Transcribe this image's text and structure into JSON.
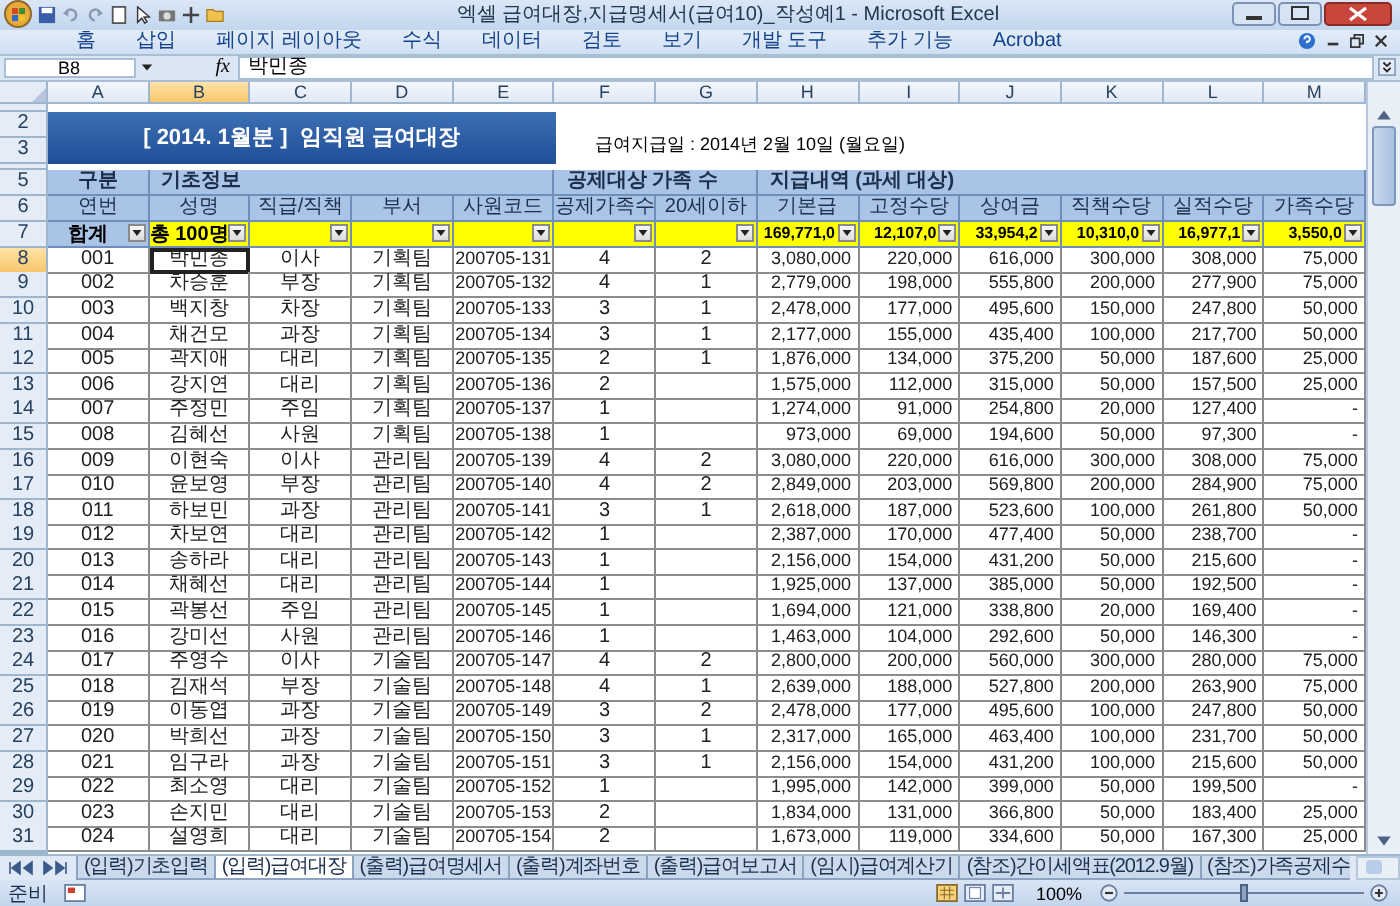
{
  "window": {
    "title": "엑셀 급여대장,지급명세서(급여10)_작성예1 - Microsoft Excel"
  },
  "ribbon_tabs": [
    "홈",
    "삽입",
    "페이지 레이아웃",
    "수식",
    "데이터",
    "검토",
    "보기",
    "개발 도구",
    "추가 기능",
    "Acrobat"
  ],
  "formula_bar": {
    "name_box": "B8",
    "function_label": "fx",
    "formula": "박민종"
  },
  "columns": [
    {
      "label": "A",
      "selected": false
    },
    {
      "label": "B",
      "selected": true
    },
    {
      "label": "C",
      "selected": false
    },
    {
      "label": "D",
      "selected": false
    },
    {
      "label": "E",
      "selected": false
    },
    {
      "label": "F",
      "selected": false
    },
    {
      "label": "G",
      "selected": false
    },
    {
      "label": "H",
      "selected": false
    },
    {
      "label": "I",
      "selected": false
    },
    {
      "label": "J",
      "selected": false
    },
    {
      "label": "K",
      "selected": false
    },
    {
      "label": "L",
      "selected": false
    },
    {
      "label": "M",
      "selected": false
    }
  ],
  "sheet": {
    "title_row_numbers": [
      "2",
      "3"
    ],
    "title": "[ 2014. 1월분 ]  임직원 급여대장",
    "pay_date": "급여지급일 : 2014년 2월 10일 (월요일)",
    "group_row_number": "5",
    "group_headers": [
      {
        "label": "구분"
      },
      {
        "label": "기초정보"
      },
      {
        "label": "공제대상 가족 수"
      },
      {
        "label": "지급내역 (과세 대상)"
      }
    ],
    "header_row_number": "6",
    "column_headers": [
      "연번",
      "성명",
      "직급/직책",
      "부서",
      "사원코드",
      "공제가족수",
      "20세이하",
      "기본급",
      "고정수당",
      "상여금",
      "직책수당",
      "실적수당",
      "가족수당"
    ],
    "totals_row_number": "7",
    "totals": [
      {
        "text": "합계",
        "filter": true
      },
      {
        "text": "총 100명",
        "filter": true
      },
      {
        "filter": true
      },
      {
        "filter": true
      },
      {
        "filter": true
      },
      {
        "filter": true
      },
      {
        "filter": true
      },
      {
        "text": "169,771,0",
        "filter": true
      },
      {
        "text": "12,107,0",
        "filter": true
      },
      {
        "text": "33,954,2",
        "filter": true
      },
      {
        "text": "10,310,0",
        "filter": true
      },
      {
        "text": "16,977,1",
        "filter": true
      },
      {
        "text": "3,550,0",
        "filter": true
      }
    ],
    "rows": [
      {
        "row_number": "8",
        "selected": true,
        "cells": [
          "001",
          "박민종",
          "이사",
          "기획팀",
          "200705-131",
          "4",
          "2",
          "3,080,000",
          "220,000",
          "616,000",
          "300,000",
          "308,000",
          "75,000"
        ]
      },
      {
        "row_number": "9",
        "selected": false,
        "cells": [
          "002",
          "차승훈",
          "부장",
          "기획팀",
          "200705-132",
          "4",
          "1",
          "2,779,000",
          "198,000",
          "555,800",
          "200,000",
          "277,900",
          "75,000"
        ]
      },
      {
        "row_number": "10",
        "selected": false,
        "cells": [
          "003",
          "백지창",
          "차장",
          "기획팀",
          "200705-133",
          "3",
          "1",
          "2,478,000",
          "177,000",
          "495,600",
          "150,000",
          "247,800",
          "50,000"
        ]
      },
      {
        "row_number": "11",
        "selected": false,
        "cells": [
          "004",
          "채건모",
          "과장",
          "기획팀",
          "200705-134",
          "3",
          "1",
          "2,177,000",
          "155,000",
          "435,400",
          "100,000",
          "217,700",
          "50,000"
        ]
      },
      {
        "row_number": "12",
        "selected": false,
        "cells": [
          "005",
          "곽지애",
          "대리",
          "기획팀",
          "200705-135",
          "2",
          "1",
          "1,876,000",
          "134,000",
          "375,200",
          "50,000",
          "187,600",
          "25,000"
        ]
      },
      {
        "row_number": "13",
        "selected": false,
        "cells": [
          "006",
          "강지연",
          "대리",
          "기획팀",
          "200705-136",
          "2",
          "",
          "1,575,000",
          "112,000",
          "315,000",
          "50,000",
          "157,500",
          "25,000"
        ]
      },
      {
        "row_number": "14",
        "selected": false,
        "cells": [
          "007",
          "주정민",
          "주임",
          "기획팀",
          "200705-137",
          "1",
          "",
          "1,274,000",
          "91,000",
          "254,800",
          "20,000",
          "127,400",
          "-"
        ]
      },
      {
        "row_number": "15",
        "selected": false,
        "cells": [
          "008",
          "김혜선",
          "사원",
          "기획팀",
          "200705-138",
          "1",
          "",
          "973,000",
          "69,000",
          "194,600",
          "50,000",
          "97,300",
          "-"
        ]
      },
      {
        "row_number": "16",
        "selected": false,
        "cells": [
          "009",
          "이현숙",
          "이사",
          "관리팀",
          "200705-139",
          "4",
          "2",
          "3,080,000",
          "220,000",
          "616,000",
          "300,000",
          "308,000",
          "75,000"
        ]
      },
      {
        "row_number": "17",
        "selected": false,
        "cells": [
          "010",
          "윤보영",
          "부장",
          "관리팀",
          "200705-140",
          "4",
          "2",
          "2,849,000",
          "203,000",
          "569,800",
          "200,000",
          "284,900",
          "75,000"
        ]
      },
      {
        "row_number": "18",
        "selected": false,
        "cells": [
          "011",
          "하보민",
          "과장",
          "관리팀",
          "200705-141",
          "3",
          "1",
          "2,618,000",
          "187,000",
          "523,600",
          "100,000",
          "261,800",
          "50,000"
        ]
      },
      {
        "row_number": "19",
        "selected": false,
        "cells": [
          "012",
          "차보연",
          "대리",
          "관리팀",
          "200705-142",
          "1",
          "",
          "2,387,000",
          "170,000",
          "477,400",
          "50,000",
          "238,700",
          "-"
        ]
      },
      {
        "row_number": "20",
        "selected": false,
        "cells": [
          "013",
          "송하라",
          "대리",
          "관리팀",
          "200705-143",
          "1",
          "",
          "2,156,000",
          "154,000",
          "431,200",
          "50,000",
          "215,600",
          "-"
        ]
      },
      {
        "row_number": "21",
        "selected": false,
        "cells": [
          "014",
          "채혜선",
          "대리",
          "관리팀",
          "200705-144",
          "1",
          "",
          "1,925,000",
          "137,000",
          "385,000",
          "50,000",
          "192,500",
          "-"
        ]
      },
      {
        "row_number": "22",
        "selected": false,
        "cells": [
          "015",
          "곽봉선",
          "주임",
          "관리팀",
          "200705-145",
          "1",
          "",
          "1,694,000",
          "121,000",
          "338,800",
          "20,000",
          "169,400",
          "-"
        ]
      },
      {
        "row_number": "23",
        "selected": false,
        "cells": [
          "016",
          "강미선",
          "사원",
          "관리팀",
          "200705-146",
          "1",
          "",
          "1,463,000",
          "104,000",
          "292,600",
          "50,000",
          "146,300",
          "-"
        ]
      },
      {
        "row_number": "24",
        "selected": false,
        "cells": [
          "017",
          "주영수",
          "이사",
          "기술팀",
          "200705-147",
          "4",
          "2",
          "2,800,000",
          "200,000",
          "560,000",
          "300,000",
          "280,000",
          "75,000"
        ]
      },
      {
        "row_number": "25",
        "selected": false,
        "cells": [
          "018",
          "김재석",
          "부장",
          "기술팀",
          "200705-148",
          "4",
          "1",
          "2,639,000",
          "188,000",
          "527,800",
          "200,000",
          "263,900",
          "75,000"
        ]
      },
      {
        "row_number": "26",
        "selected": false,
        "cells": [
          "019",
          "이동엽",
          "과장",
          "기술팀",
          "200705-149",
          "3",
          "2",
          "2,478,000",
          "177,000",
          "495,600",
          "100,000",
          "247,800",
          "50,000"
        ]
      },
      {
        "row_number": "27",
        "selected": false,
        "cells": [
          "020",
          "박희선",
          "과장",
          "기술팀",
          "200705-150",
          "3",
          "1",
          "2,317,000",
          "165,000",
          "463,400",
          "100,000",
          "231,700",
          "50,000"
        ]
      },
      {
        "row_number": "28",
        "selected": false,
        "cells": [
          "021",
          "임구라",
          "과장",
          "기술팀",
          "200705-151",
          "3",
          "1",
          "2,156,000",
          "154,000",
          "431,200",
          "100,000",
          "215,600",
          "50,000"
        ]
      },
      {
        "row_number": "29",
        "selected": false,
        "cells": [
          "022",
          "최소영",
          "대리",
          "기술팀",
          "200705-152",
          "1",
          "",
          "1,995,000",
          "142,000",
          "399,000",
          "50,000",
          "199,500",
          "-"
        ]
      },
      {
        "row_number": "30",
        "selected": false,
        "cells": [
          "023",
          "손지민",
          "대리",
          "기술팀",
          "200705-153",
          "2",
          "",
          "1,834,000",
          "131,000",
          "366,800",
          "50,000",
          "183,400",
          "25,000"
        ]
      },
      {
        "row_number": "31",
        "selected": false,
        "cells": [
          "024",
          "설영희",
          "대리",
          "기술팀",
          "200705-154",
          "2",
          "",
          "1,673,000",
          "119,000",
          "334,600",
          "50,000",
          "167,300",
          "25,000"
        ]
      }
    ]
  },
  "sheet_tabs": [
    {
      "label": "(입력)기초입력",
      "selected": false
    },
    {
      "label": "(입력)급여대장",
      "selected": true
    },
    {
      "label": "(출력)급여명세서",
      "selected": false
    },
    {
      "label": "(출력)계좌번호",
      "selected": false
    },
    {
      "label": "(출력)급여보고서",
      "selected": false
    },
    {
      "label": "(임시)급여계산기",
      "selected": false
    },
    {
      "label": "(참조)간이세액표(2012.9월)",
      "selected": false
    },
    {
      "label": "(참조)가족공제수",
      "selected": false
    }
  ],
  "status_bar": {
    "status": "준비",
    "zoom": "100%",
    "zoom_slider": {
      "level": 0.5
    }
  }
}
